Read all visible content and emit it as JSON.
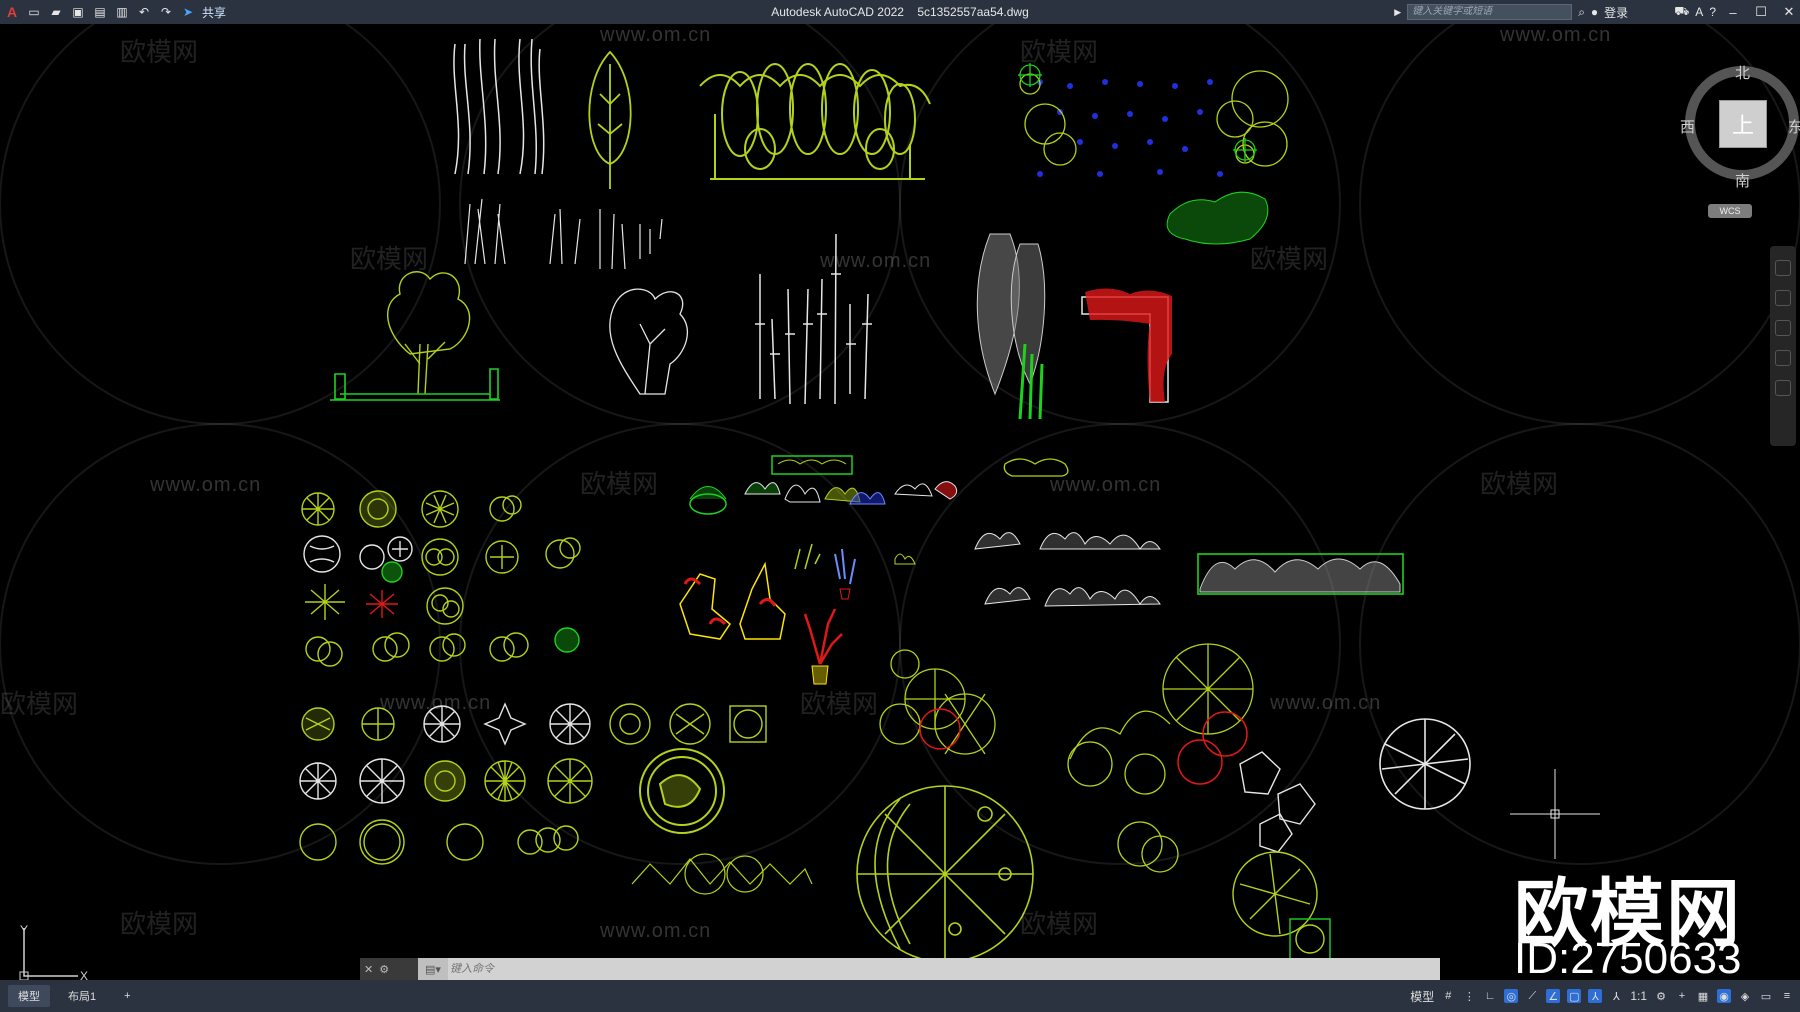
{
  "app": {
    "title": "Autodesk AutoCAD 2022",
    "filename": "5c1352557aa54.dwg",
    "share_label": "共享",
    "search_placeholder": "键入关键字或短语",
    "login_label": "登录"
  },
  "viewcube": {
    "north": "北",
    "south": "南",
    "east": "东",
    "west": "西",
    "face": "上",
    "wcs": "WCS"
  },
  "ucs": {
    "x": "X",
    "y": "Y"
  },
  "watermark": {
    "brand": "欧模网",
    "url": "www.om.cn",
    "id": "ID:2750633"
  },
  "command": {
    "placeholder": "键入命令"
  },
  "status": {
    "tabs": [
      "模型",
      "布局1"
    ],
    "model_label": "模型",
    "scale": "1:1"
  },
  "colors": {
    "background": "#000000",
    "yellow_green": "#b3d21a",
    "green": "#1fd11f",
    "white": "#e6e6e6",
    "red": "#e01818",
    "blue": "#2030e0",
    "ui_bar": "#2b3340"
  }
}
